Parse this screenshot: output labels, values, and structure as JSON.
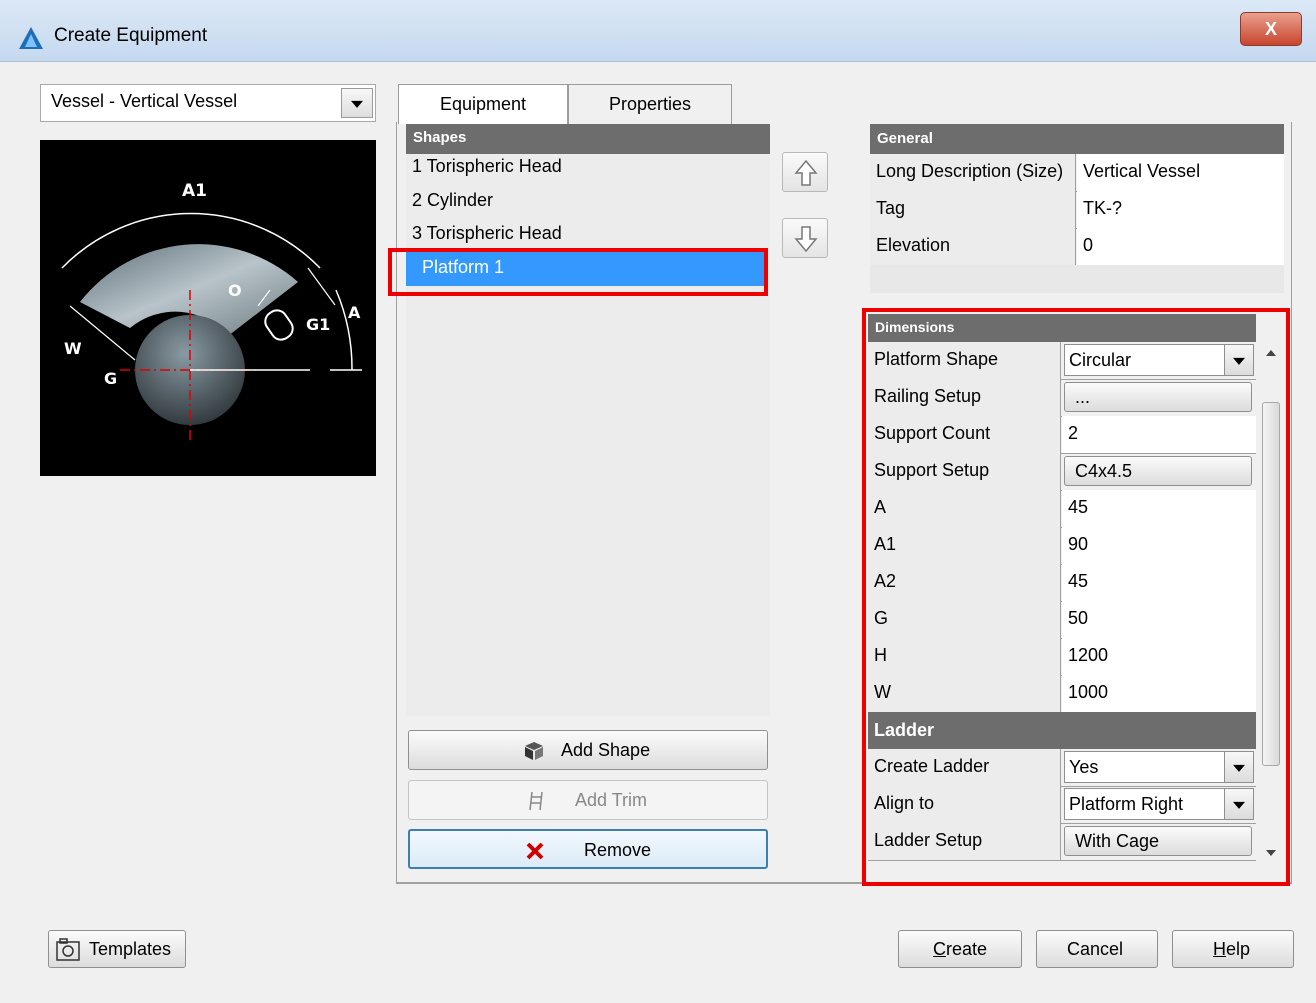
{
  "window": {
    "title": "Create Equipment",
    "close_label": "X"
  },
  "equipment_type": {
    "selected": "Vessel - Vertical Vessel"
  },
  "preview": {
    "labels": [
      "A1",
      "O",
      "G1",
      "A",
      "W",
      "G"
    ]
  },
  "tabs": [
    {
      "label": "Equipment",
      "active": true
    },
    {
      "label": "Properties",
      "active": false
    }
  ],
  "shapes": {
    "header": "Shapes",
    "items": [
      "1 Torispheric Head",
      "2 Cylinder",
      "3 Torispheric Head",
      "Platform 1"
    ],
    "selected_index": 3
  },
  "actions": {
    "add_shape": "Add Shape",
    "add_trim": "Add Trim",
    "remove": "Remove"
  },
  "general": {
    "header": "General",
    "rows": [
      {
        "name": "Long Description (Size)",
        "value": "Vertical Vessel"
      },
      {
        "name": "Tag",
        "value": "TK-?"
      },
      {
        "name": "Elevation",
        "value": "0"
      }
    ]
  },
  "dimensions": {
    "header": "Dimensions",
    "platform_shape": {
      "name": "Platform Shape",
      "value": "Circular"
    },
    "railing_setup": {
      "name": "Railing Setup",
      "value": "..."
    },
    "support_count": {
      "name": "Support Count",
      "value": "2"
    },
    "support_setup": {
      "name": "Support Setup",
      "value": "C4x4.5"
    },
    "rows": [
      {
        "name": "A",
        "value": "45"
      },
      {
        "name": "A1",
        "value": "90"
      },
      {
        "name": "A2",
        "value": "45"
      },
      {
        "name": "G",
        "value": "50"
      },
      {
        "name": "H",
        "value": "1200"
      },
      {
        "name": "W",
        "value": "1000"
      }
    ],
    "ladder_header": "Ladder",
    "create_ladder": {
      "name": "Create Ladder",
      "value": "Yes"
    },
    "align_to": {
      "name": "Align to",
      "value": "Platform Right"
    },
    "ladder_setup": {
      "name": "Ladder Setup",
      "value": "With Cage"
    }
  },
  "footer": {
    "templates": "Templates",
    "create_first": "C",
    "create_rest": "reate",
    "cancel": "Cancel",
    "help_first": "H",
    "help_rest": "elp"
  },
  "colors": {
    "selection": "#3399ff",
    "highlight": "#ee0000",
    "grid_header": "#6d6d6d"
  }
}
